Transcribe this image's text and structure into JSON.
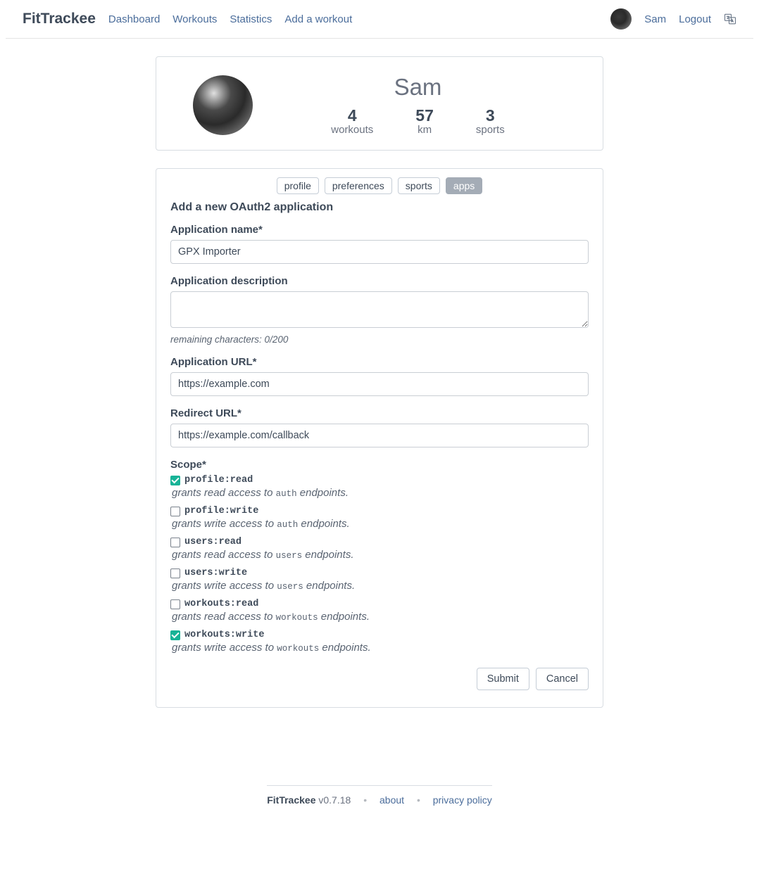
{
  "brand": "FitTrackee",
  "nav": {
    "dashboard": "Dashboard",
    "workouts": "Workouts",
    "statistics": "Statistics",
    "add_workout": "Add a workout",
    "user": "Sam",
    "logout": "Logout"
  },
  "profile": {
    "username": "Sam",
    "stats": {
      "workouts_n": "4",
      "workouts_l": "workouts",
      "km_n": "57",
      "km_l": "km",
      "sports_n": "3",
      "sports_l": "sports"
    }
  },
  "tabs": {
    "profile": "profile",
    "preferences": "preferences",
    "sports": "sports",
    "apps": "apps"
  },
  "form": {
    "title": "Add a new OAuth2 application",
    "app_name_label": "Application name*",
    "app_name_value": "GPX Importer",
    "app_desc_label": "Application description",
    "app_desc_value": "",
    "app_desc_hint": "remaining characters: 0/200",
    "app_url_label": "Application URL*",
    "app_url_value": "https://example.com",
    "redirect_url_label": "Redirect URL*",
    "redirect_url_value": "https://example.com/callback",
    "scope_label": "Scope*",
    "scopes": [
      {
        "name": "profile:read",
        "checked": true,
        "desc_pre": "grants read access to ",
        "desc_code": "auth",
        "desc_post": " endpoints."
      },
      {
        "name": "profile:write",
        "checked": false,
        "desc_pre": "grants write access to ",
        "desc_code": "auth",
        "desc_post": " endpoints."
      },
      {
        "name": "users:read",
        "checked": false,
        "desc_pre": "grants read access to ",
        "desc_code": "users",
        "desc_post": " endpoints."
      },
      {
        "name": "users:write",
        "checked": false,
        "desc_pre": "grants write access to ",
        "desc_code": "users",
        "desc_post": " endpoints."
      },
      {
        "name": "workouts:read",
        "checked": false,
        "desc_pre": "grants read access to ",
        "desc_code": "workouts",
        "desc_post": " endpoints."
      },
      {
        "name": "workouts:write",
        "checked": true,
        "desc_pre": "grants write access to ",
        "desc_code": "workouts",
        "desc_post": " endpoints."
      }
    ],
    "submit": "Submit",
    "cancel": "Cancel"
  },
  "footer": {
    "brand": "FitTrackee",
    "version": "v0.7.18",
    "about": "about",
    "privacy": "privacy policy"
  }
}
